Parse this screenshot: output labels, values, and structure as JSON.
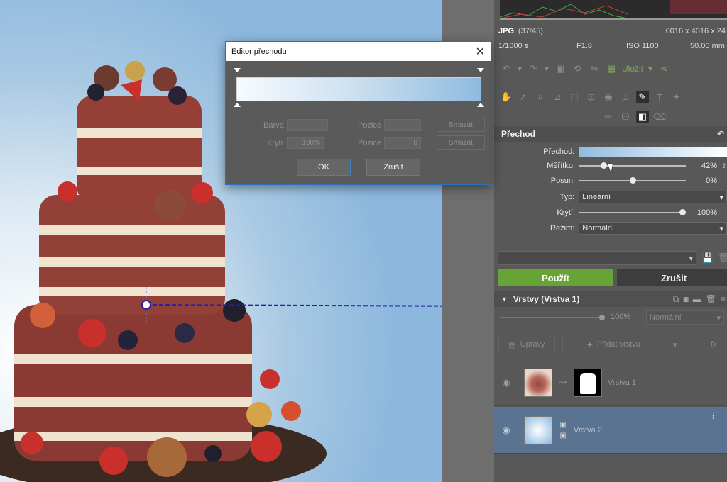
{
  "image_info": {
    "format": "JPG",
    "counter": "(37/45)",
    "dimensions": "6016 x 4016 x 24",
    "shutter": "1/1000 s",
    "aperture": "F1.8",
    "iso": "ISO 1100",
    "focal": "50.00 mm"
  },
  "toolbar": {
    "save_label": "Uložit"
  },
  "tool_section": {
    "title": "Přechod"
  },
  "properties": {
    "gradient_label": "Přechod:",
    "scale_label": "Měřítko:",
    "scale_value": "42%",
    "scale_fraction": 0.42,
    "shift_label": "Posun:",
    "shift_value": "0%",
    "shift_fraction": 0.5,
    "type_label": "Typ:",
    "type_value": "Lineární",
    "opacity_label": "Krytí:",
    "opacity_value": "100%",
    "opacity_fraction": 1.0,
    "mode_label": "Režim:",
    "mode_value": "Normální"
  },
  "actions": {
    "apply": "Použít",
    "cancel": "Zrušit"
  },
  "layers": {
    "title": "Vrstvy (Vrstva 1)",
    "opacity": "100%",
    "blend": "Normální",
    "adjust_label": "Úpravy",
    "add_layer_label": "Přidat vrstvu",
    "fx_label": "fx",
    "items": [
      {
        "name": "Vrstva 1"
      },
      {
        "name": "Vrstva 2"
      }
    ]
  },
  "dialog": {
    "title": "Editor přechodu",
    "color_label": "Barva",
    "opacity_label": "Krytí",
    "opacity_value": "100%",
    "position_label_1": "Pozice",
    "position_label_2": "Pozice",
    "position_value_2": "0",
    "delete_1": "Smazat",
    "delete_2": "Smazat",
    "ok": "OK",
    "cancel": "Zrušit"
  },
  "colors": {
    "accent_green": "#66a436",
    "gradient_blue": "#8fbbe0",
    "dialog_border": "#2f6fb3"
  }
}
